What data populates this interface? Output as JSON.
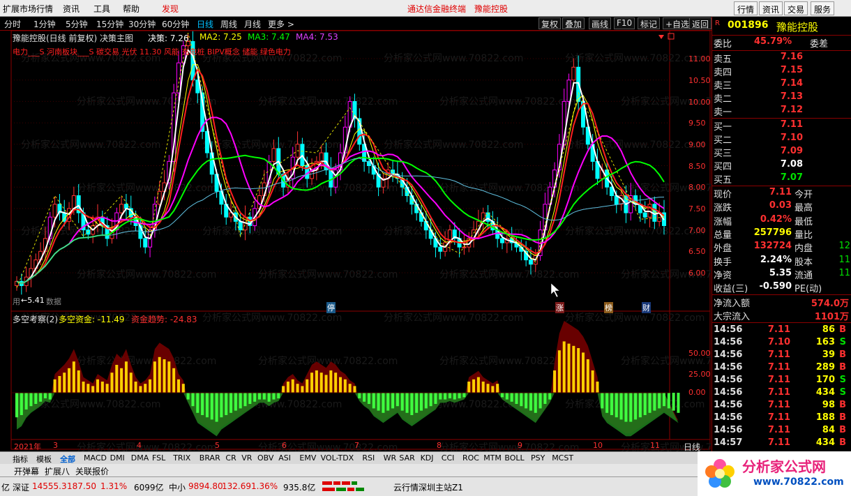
{
  "menu": {
    "items": [
      "扩展市场行情",
      "资讯",
      "工具",
      "帮助"
    ],
    "hot": "发现",
    "promo1": "通达信金融终端",
    "promo2": "豫能控股",
    "right_buttons": [
      "行情",
      "资讯",
      "交易",
      "服务"
    ]
  },
  "periods": [
    "分时",
    "1分钟",
    "5分钟",
    "15分钟",
    "30分钟",
    "60分钟",
    "日线",
    "周线",
    "月线",
    "更多 >"
  ],
  "selected_period": "日线",
  "tool_buttons": [
    "复权",
    "叠加",
    "画线",
    "F10",
    "标记",
    "+自选",
    "返回"
  ],
  "main_title": {
    "name": "豫能控股(日线 前复权) 决策主图",
    "decision": "决策: 7.26",
    "ma2": "MA2: 7.25",
    "ma3": "MA3: 7.47",
    "ma4": "MA4: 7.53"
  },
  "concepts": "电力___S 河南板块___S 碳交易 光伏 11.30 风能 充电桩 BIPV概念 储能 绿色电力",
  "low_label": "←5.41",
  "low_prefix": "用",
  "low_suffix": "数据",
  "markers": [
    "停",
    "涨",
    "榜",
    "财"
  ],
  "indicator_title": {
    "name": "多空考察(2)",
    "v1": "多空资金: -11.49",
    "v2": "资金趋势: -24.83"
  },
  "x_axis": {
    "year": "2021年",
    "months": [
      "3",
      "4",
      "5",
      "6",
      "7",
      "8",
      "9",
      "10",
      "11"
    ],
    "period": "日线"
  },
  "price_axis": [
    "11.00",
    "10.50",
    "10.00",
    "9.50",
    "9.00",
    "8.50",
    "8.00",
    "7.50",
    "7.00",
    "6.50",
    "6.00"
  ],
  "ind_axis": [
    "50.00",
    "25.00",
    "0.00"
  ],
  "colors": {
    "up": "#ff3232",
    "down": "#00ffff",
    "ma1": "#ffffff",
    "ma2": "#ffff00",
    "ma3": "#00ff00",
    "ma4": "#ff00ff",
    "ma5": "#60c0e0"
  },
  "chart_data": {
    "type": "candlestick",
    "ylim": [
      6.0,
      11.0
    ],
    "close": [
      5.8,
      5.7,
      5.9,
      6.1,
      6.3,
      6.5,
      6.8,
      7.3,
      7.6,
      7.4,
      7.2,
      7.5,
      7.8,
      7.4,
      7.0,
      6.9,
      7.1,
      7.3,
      7.1,
      6.8,
      7.0,
      7.4,
      7.6,
      7.5,
      7.3,
      7.1,
      6.8,
      6.6,
      7.0,
      7.6,
      7.9,
      8.1,
      8.6,
      10.2,
      10.9,
      11.3,
      11.4,
      10.5,
      10.2,
      9.3,
      8.8,
      8.3,
      7.9,
      7.6,
      7.3,
      7.4,
      7.2,
      7.0,
      7.3,
      7.1,
      7.5,
      7.8,
      8.1,
      8.6,
      8.9,
      8.3,
      8.0,
      8.2,
      8.7,
      9.0,
      8.5,
      8.2,
      8.4,
      8.6,
      8.8,
      8.4,
      8.0,
      8.4,
      8.8,
      9.4,
      10.0,
      9.6,
      9.0,
      8.6,
      8.5,
      8.3,
      8.0,
      8.2,
      8.4,
      8.3,
      8.2,
      8.0,
      7.8,
      7.6,
      7.4,
      7.2,
      7.0,
      6.8,
      6.6,
      6.5,
      6.7,
      7.0,
      6.8,
      6.6,
      6.6,
      6.8,
      7.0,
      7.2,
      7.4,
      7.2,
      7.0,
      6.8,
      6.7,
      6.8,
      6.7,
      6.6,
      6.5,
      6.3,
      6.2,
      6.4,
      7.0,
      7.6,
      8.0,
      8.4,
      9.0,
      10.0,
      10.5,
      10.8,
      10.0,
      9.4,
      9.0,
      8.6,
      8.2,
      8.4,
      8.0,
      7.8,
      7.6,
      7.8,
      7.4,
      7.8,
      7.6,
      7.4,
      7.3,
      7.6,
      7.2,
      7.4,
      7.1
    ]
  },
  "ind_data": {
    "type": "bar",
    "values": [
      -22,
      -20,
      -15,
      -12,
      -10,
      -8,
      -5,
      -6,
      12,
      15,
      18,
      22,
      28,
      20,
      10,
      8,
      6,
      12,
      10,
      8,
      18,
      25,
      22,
      28,
      18,
      10,
      6,
      8,
      12,
      28,
      32,
      30,
      28,
      22,
      12,
      8,
      -6,
      -12,
      -18,
      -20,
      -22,
      -24,
      -26,
      -22,
      -20,
      -18,
      -16,
      -14,
      -12,
      -10,
      -8,
      -6,
      -6,
      -8,
      -6,
      -5,
      6,
      10,
      12,
      8,
      6,
      12,
      18,
      20,
      18,
      16,
      20,
      18,
      14,
      12,
      8,
      6,
      -5,
      -8,
      -10,
      -14,
      -16,
      -18,
      -16,
      -14,
      -12,
      -16,
      -18,
      -20,
      -18,
      -16,
      -14,
      -12,
      -10,
      -6,
      -6,
      -5,
      -6,
      -5,
      -4,
      10,
      12,
      14,
      10,
      8,
      6,
      8,
      -4,
      -6,
      -8,
      -10,
      -12,
      -14,
      -16,
      -18,
      -14,
      -10,
      -6,
      20,
      38,
      46,
      44,
      42,
      40,
      36,
      30,
      20,
      10,
      -14,
      -18,
      -20,
      -22,
      -24,
      -26,
      -26,
      -24,
      -22,
      -20,
      -18,
      -16,
      -14,
      -12,
      -14,
      -16,
      -18
    ]
  },
  "quote": {
    "code": "001896",
    "name": "豫能控股",
    "wb_label": "委比",
    "wb_value": "45.79%",
    "wc_label": "委差",
    "asks": [
      [
        "卖五",
        "7.16"
      ],
      [
        "卖四",
        "7.15"
      ],
      [
        "卖三",
        "7.14"
      ],
      [
        "卖二",
        "7.13"
      ],
      [
        "卖一",
        "7.12"
      ]
    ],
    "bids": [
      [
        "买一",
        "7.11"
      ],
      [
        "买二",
        "7.10"
      ],
      [
        "买三",
        "7.09"
      ],
      [
        "买四",
        "7.08"
      ],
      [
        "买五",
        "7.07"
      ]
    ],
    "stats": [
      [
        "现价",
        "7.11",
        "今开",
        ""
      ],
      [
        "涨跌",
        "0.03",
        "最高",
        ""
      ],
      [
        "涨幅",
        "0.42%",
        "最低",
        ""
      ],
      [
        "总量",
        "257796",
        "量比",
        ""
      ],
      [
        "外盘",
        "132724",
        "内盘",
        "12"
      ],
      [
        "换手",
        "2.24%",
        "股本",
        "11"
      ],
      [
        "净资",
        "5.35",
        "流通",
        "11"
      ],
      [
        "收益(三)",
        "-0.590",
        "PE(动)",
        ""
      ]
    ],
    "flow": [
      [
        "净流入额",
        "574.0万"
      ],
      [
        "大宗流入",
        "1101万"
      ]
    ],
    "ticks": [
      [
        "14:56",
        "7.11",
        "86",
        "B"
      ],
      [
        "14:56",
        "7.10",
        "163",
        "S"
      ],
      [
        "14:56",
        "7.11",
        "39",
        "B"
      ],
      [
        "14:56",
        "7.11",
        "289",
        "B"
      ],
      [
        "14:56",
        "7.11",
        "170",
        "S"
      ],
      [
        "14:56",
        "7.11",
        "434",
        "S"
      ],
      [
        "14:56",
        "7.11",
        "98",
        "B"
      ],
      [
        "14:56",
        "7.11",
        "188",
        "B"
      ],
      [
        "14:56",
        "7.11",
        "84",
        "B"
      ],
      [
        "14:57",
        "7.11",
        "434",
        "B"
      ]
    ]
  },
  "ind_tabs": [
    "指标",
    "模板",
    "全部",
    "MACD",
    "DMI",
    "DMA",
    "FSL",
    "TRIX",
    "BRAR",
    "CR",
    "VR",
    "OBV",
    "ASI",
    "EMV",
    "VOL-TDX",
    "RSI",
    "WR",
    "SAR",
    "KDJ",
    "CCI",
    "ROC",
    "MTM",
    "BOLL",
    "PSY",
    "MCST"
  ],
  "sub_tabs": [
    "开弹幕",
    "扩展八",
    "关联报价"
  ],
  "status": {
    "s0": "亿",
    "sz_label": "深证",
    "sz": "14555.3",
    "sz_chg": "187.50",
    "sz_pct": "1.31%",
    "sz_amt": "6099亿",
    "zx_label": "中小",
    "zx": "9894.80",
    "zx_chg": "132.69",
    "zx_pct": "1.36%",
    "zx_amt": "935.8亿",
    "server": "云行情深圳主站Z1"
  },
  "logo": {
    "text": "分析家公式网",
    "url": "www.70822.com"
  },
  "watermark": "分析家公式网www.70822.com"
}
